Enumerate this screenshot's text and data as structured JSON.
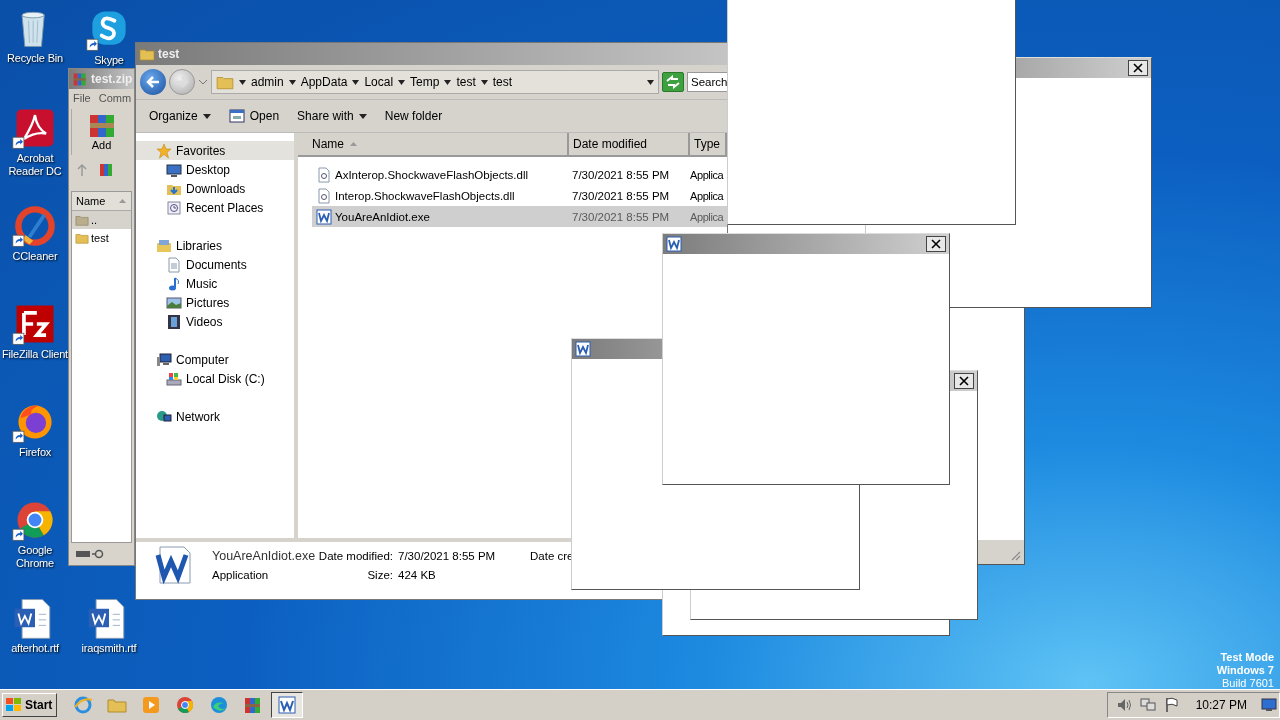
{
  "desktop_icons": [
    {
      "label": "Recycle Bin",
      "kind": "recycle-bin",
      "shortcut": false
    },
    {
      "label": "Skype",
      "kind": "skype",
      "shortcut": true
    },
    {
      "label": "Acrobat Reader DC",
      "kind": "acrobat",
      "shortcut": true
    },
    {
      "label": "CCleaner",
      "kind": "ccleaner",
      "shortcut": true
    },
    {
      "label": "FileZilla Client",
      "kind": "filezilla",
      "shortcut": true
    },
    {
      "label": "Firefox",
      "kind": "firefox",
      "shortcut": true
    },
    {
      "label": "Google Chrome",
      "kind": "chrome",
      "shortcut": true
    },
    {
      "label": "afterhot.rtf",
      "kind": "word-document",
      "shortcut": false
    },
    {
      "label": "iraqsmith.rtf",
      "kind": "word-document",
      "shortcut": false
    }
  ],
  "winrar_window": {
    "title": "test.zip",
    "menu": [
      "File",
      "Comm"
    ],
    "add_label": "Add",
    "column": "Name",
    "rows": [
      {
        "name": "..",
        "kind": "parent",
        "selected": true
      },
      {
        "name": "test",
        "kind": "folder",
        "selected": false
      }
    ]
  },
  "explorer": {
    "title": "test",
    "breadcrumb": [
      "admin",
      "AppData",
      "Local",
      "Temp",
      "test",
      "test"
    ],
    "search_placeholder": "Search",
    "toolbar": [
      {
        "label": "Organize",
        "kind": "menu"
      },
      {
        "label": "Open",
        "kind": "open"
      },
      {
        "label": "Share with",
        "kind": "menu"
      },
      {
        "label": "New folder",
        "kind": "plain"
      }
    ],
    "nav": [
      {
        "label": "Favorites",
        "kind": "favorites",
        "selected": true,
        "children": [
          {
            "label": "Desktop",
            "kind": "desktop",
            "selected": false
          },
          {
            "label": "Downloads",
            "kind": "downloads",
            "selected": false
          },
          {
            "label": "Recent Places",
            "kind": "recent",
            "selected": false
          }
        ]
      },
      {
        "label": "Libraries",
        "kind": "libraries",
        "selected": false,
        "children": [
          {
            "label": "Documents",
            "kind": "documents",
            "selected": false
          },
          {
            "label": "Music",
            "kind": "music",
            "selected": false
          },
          {
            "label": "Pictures",
            "kind": "pictures",
            "selected": false
          },
          {
            "label": "Videos",
            "kind": "videos",
            "selected": false
          }
        ]
      },
      {
        "label": "Computer",
        "kind": "computer",
        "selected": false,
        "children": [
          {
            "label": "Local Disk (C:)",
            "kind": "disk",
            "selected": false
          }
        ]
      },
      {
        "label": "Network",
        "kind": "network",
        "selected": false
      }
    ],
    "columns": [
      "Name",
      "Date modified",
      "Type"
    ],
    "files": [
      {
        "name": "AxInterop.ShockwaveFlashObjects.dll",
        "date": "7/30/2021 8:55 PM",
        "type": "Applica",
        "kind": "dll",
        "selected": false
      },
      {
        "name": "Interop.ShockwaveFlashObjects.dll",
        "date": "7/30/2021 8:55 PM",
        "type": "Applica",
        "kind": "dll",
        "selected": false
      },
      {
        "name": "YouAreAnIdiot.exe",
        "date": "7/30/2021 8:55 PM",
        "type": "Applica",
        "kind": "exe",
        "selected": true
      }
    ],
    "details": {
      "name": "YouAreAnIdiot.exe",
      "type": "Application",
      "fields": [
        {
          "label": "Date modified:",
          "value": "7/30/2021 8:55 PM"
        },
        {
          "label": "Size:",
          "value": "424 KB"
        }
      ],
      "column_3_label": "Date cre"
    }
  },
  "taskbar": {
    "start": "Start",
    "apps": [
      {
        "kind": "ie",
        "active": false
      },
      {
        "kind": "explorer",
        "active": false
      },
      {
        "kind": "media-player",
        "active": false
      },
      {
        "kind": "chrome",
        "active": false
      },
      {
        "kind": "edge",
        "active": false
      },
      {
        "kind": "winrar",
        "active": false
      },
      {
        "kind": "word",
        "active": true
      }
    ],
    "clock": "10:27 PM"
  },
  "system_notice": [
    "Test Mode",
    "Windows 7",
    "Build 7601"
  ]
}
